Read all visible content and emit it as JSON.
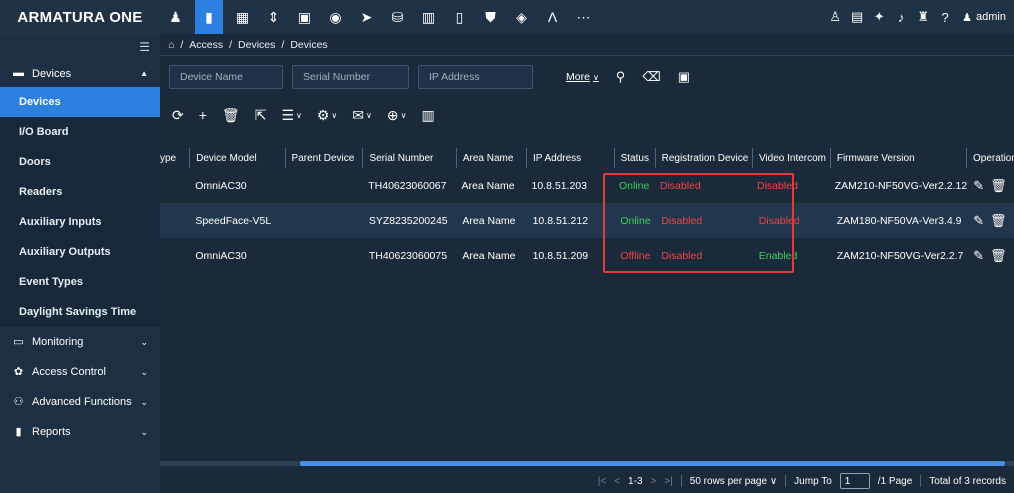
{
  "brand": "ARMATURA ONE",
  "topbar": {
    "icons": [
      "person-icon",
      "door-icon",
      "calendar-icon",
      "elevator-icon",
      "camera-box-icon",
      "location-icon",
      "cctv-icon",
      "briefcase-icon",
      "building-icon",
      "phone-icon",
      "shield-icon",
      "globe-icon",
      "a-logo-icon",
      "more-icon"
    ],
    "icon_glyphs": [
      "♟",
      "▮",
      "▦",
      "⇕",
      "▣",
      "◉",
      "➤",
      "⛁",
      "▥",
      "▯",
      "⛊",
      "◈",
      "Λ",
      "⋯"
    ],
    "right_icons": [
      "user-group-icon",
      "id-card-icon",
      "pin-icon",
      "bell-icon",
      "castle-icon",
      "help-icon"
    ],
    "right_glyphs": [
      "♙",
      "▤",
      "✦",
      "♪",
      "♜",
      "?"
    ],
    "user": "admin"
  },
  "breadcrumb": [
    "Access",
    "Devices",
    "Devices"
  ],
  "filters": {
    "device_name": "Device Name",
    "serial_number": "Serial Number",
    "ip_address": "IP Address",
    "more": "More"
  },
  "sidebar": {
    "devices_group": "Devices",
    "items": [
      "Devices",
      "I/O Board",
      "Doors",
      "Readers",
      "Auxiliary Inputs",
      "Auxiliary Outputs",
      "Event Types",
      "Daylight Savings Time"
    ],
    "active_index": 0,
    "groups": [
      "Monitoring",
      "Access Control",
      "Advanced Functions",
      "Reports"
    ]
  },
  "table": {
    "headers": [
      "ype",
      "Device Model",
      "Parent Device",
      "Serial Number",
      "Area Name",
      "IP Address",
      "Status",
      "Registration Device",
      "Video Intercom",
      "Firmware Version",
      "Operation"
    ],
    "rows": [
      {
        "model": "OmniAC30",
        "parent": "",
        "serial": "TH40623060067",
        "area": "Area Name",
        "ip": "10.8.51.203",
        "status": "Online",
        "reg": "Disabled",
        "video": "Disabled",
        "firmware": "ZAM210-NF50VG-Ver2.2.12"
      },
      {
        "model": "SpeedFace-V5L",
        "parent": "",
        "serial": "SYZ8235200245",
        "area": "Area Name",
        "ip": "10.8.51.212",
        "status": "Online",
        "reg": "Disabled",
        "video": "Disabled",
        "firmware": "ZAM180-NF50VA-Ver3.4.9"
      },
      {
        "model": "OmniAC30",
        "parent": "",
        "serial": "TH40623060075",
        "area": "Area Name",
        "ip": "10.8.51.209",
        "status": "Offline",
        "reg": "Disabled",
        "video": "Enabled",
        "firmware": "ZAM210-NF50VG-Ver2.2.7"
      }
    ]
  },
  "pager": {
    "range": "1-3",
    "rows_per_page": "50 rows per page",
    "jump_to": "Jump To",
    "jump_value": "1",
    "pages": "/1 Page",
    "total": "Total of 3 records"
  },
  "colors": {
    "accent": "#2d7fe0",
    "online": "#3fcf5c",
    "alert": "#ef4444"
  }
}
